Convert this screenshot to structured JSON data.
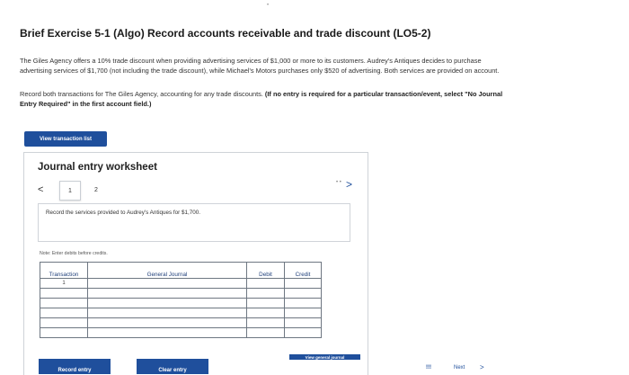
{
  "exercise": {
    "title": "Brief Exercise 5-1 (Algo) Record accounts receivable and trade discount (LO5-2)",
    "paragraph1": "The Giles Agency offers a 10% trade discount when providing advertising services of $1,000 or more to its customers. Audrey's Antiques decides to purchase advertising services of $1,700 (not including the trade discount), while Michael's Motors purchases only $520 of advertising. Both services are provided on account.",
    "paragraph2_normal": "Record both transactions for The Giles Agency, accounting for any trade discounts. ",
    "paragraph2_bold": "(If no entry is required for a particular transaction/event, select \"No Journal Entry Required\" in the first account field.)",
    "view_transaction_label": "View transaction list"
  },
  "worksheet": {
    "title": "Journal entry worksheet",
    "prev_icon": "<",
    "next_icon": ">",
    "dots": "• •",
    "tabs": [
      "1",
      "2"
    ],
    "description": "Record the services provided to Audrey's Antiques for $1,700.",
    "note": "Note: Enter debits before credits.",
    "table": {
      "headers": {
        "transaction": "Transaction",
        "general_journal": "General Journal",
        "debit": "Debit",
        "credit": "Credit"
      },
      "rows": [
        {
          "transaction": "1"
        },
        {
          "transaction": ""
        },
        {
          "transaction": ""
        },
        {
          "transaction": ""
        },
        {
          "transaction": ""
        },
        {
          "transaction": ""
        }
      ]
    },
    "record_entry_label": "Record entry",
    "clear_entry_label": "Clear entry",
    "view_general_journal_label": "View general journal"
  },
  "pager": {
    "dots": "!!!",
    "next_label": "Next",
    "next_icon": ">"
  },
  "colors": {
    "primary_button": "#1f4f9c",
    "table_header_text": "#1f3f7a"
  }
}
